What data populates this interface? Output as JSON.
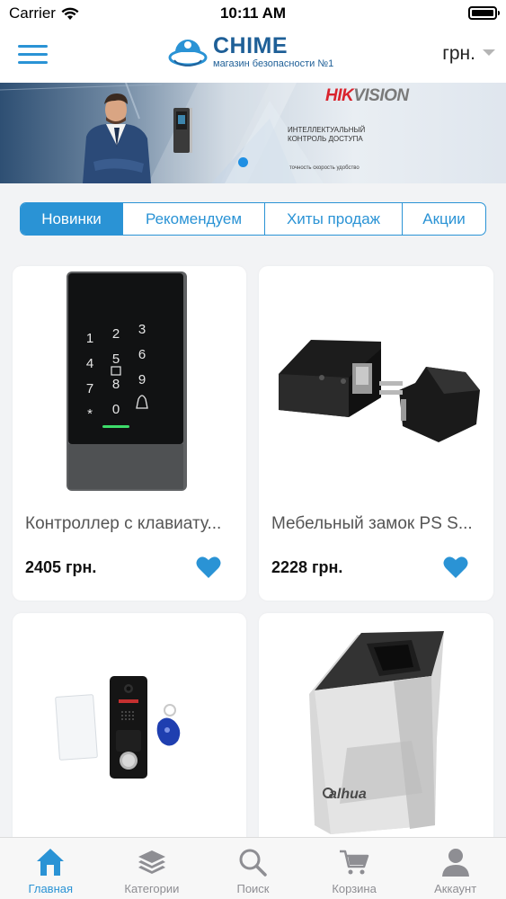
{
  "status_bar": {
    "carrier": "Carrier",
    "time": "10:11 AM"
  },
  "header": {
    "brand": "CHIME",
    "tagline": "магазин безопасности №1",
    "currency": "грн."
  },
  "banner": {
    "brand_red": "HIK",
    "brand_gray": "VISION",
    "title": "ИНТЕЛЛЕКТУАЛЬНЫЙ КОНТРОЛЬ ДОСТУПА",
    "subtitle": "точность скорость удобство"
  },
  "tabs": [
    {
      "label": "Новинки",
      "active": true
    },
    {
      "label": "Рекомендуем",
      "active": false
    },
    {
      "label": "Хиты продаж",
      "active": false
    },
    {
      "label": "Акции",
      "active": false
    }
  ],
  "products": [
    {
      "title": "Контроллер с клавиату...",
      "price": "2405 грн."
    },
    {
      "title": "Мебельный замок PS S...",
      "price": "2228 грн."
    },
    {
      "title": "",
      "price": ""
    },
    {
      "title": "",
      "price": ""
    }
  ],
  "tabbar": [
    {
      "label": "Главная",
      "icon": "home-icon",
      "active": true
    },
    {
      "label": "Категории",
      "icon": "layers-icon",
      "active": false
    },
    {
      "label": "Поиск",
      "icon": "search-icon",
      "active": false
    },
    {
      "label": "Корзина",
      "icon": "cart-icon",
      "active": false
    },
    {
      "label": "Аккаунт",
      "icon": "user-icon",
      "active": false
    }
  ],
  "colors": {
    "accent": "#2a93d5",
    "brand": "#1e5f97",
    "banner_brand": "#d9232d"
  }
}
